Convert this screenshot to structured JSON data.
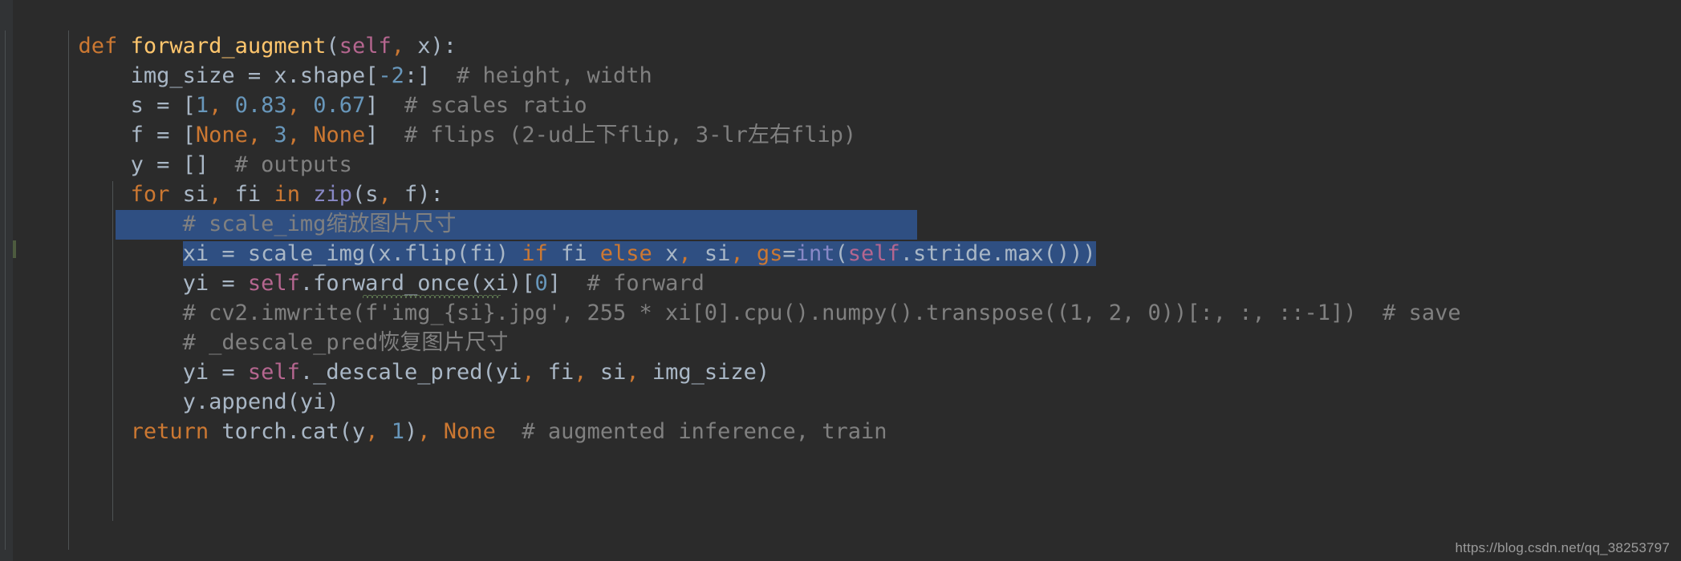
{
  "editor": {
    "language": "python",
    "theme": "darcula",
    "background_color": "#2b2b2b",
    "gutter_color": "#313335",
    "selection_color": "#2f4f82",
    "default_text_color": "#a9b7c6",
    "comment_color": "#808080",
    "keyword_color": "#cc7832",
    "number_color": "#6897bb",
    "function_color": "#ffc66d",
    "self_color": "#94558d",
    "builtin_color": "#8888c6",
    "error_squiggle_color": "#6a8759"
  },
  "code_lines": [
    {
      "id": "line-1",
      "indent": 1,
      "text": "def forward_augment(self, x):",
      "selected": false
    },
    {
      "id": "line-2",
      "indent": 2,
      "text": "img_size = x.shape[-2:]  # height, width",
      "selected": false
    },
    {
      "id": "line-3",
      "indent": 2,
      "text": "s = [1, 0.83, 0.67]  # scales ratio",
      "selected": false
    },
    {
      "id": "line-4",
      "indent": 2,
      "text": "f = [None, 3, None]  # flips (2-ud上下flip, 3-lr左右flip)",
      "selected": false
    },
    {
      "id": "line-5",
      "indent": 2,
      "text": "y = []  # outputs",
      "selected": false
    },
    {
      "id": "line-6",
      "indent": 2,
      "text": "for si, fi in zip(s, f):",
      "selected": false
    },
    {
      "id": "line-7",
      "indent": 3,
      "text": "# scale_img缩放图片尺寸",
      "selected": false
    },
    {
      "id": "line-8",
      "indent": 3,
      "text": "xi = scale_img(x.flip(fi) if fi else x, si, gs=int(self.stride.max()))",
      "selected": true
    },
    {
      "id": "line-9",
      "indent": 3,
      "text": "yi = self.forward_once(xi)[0]  # forward",
      "selected": false
    },
    {
      "id": "line-10",
      "indent": 3,
      "text": "# cv2.imwrite(f'img_{si}.jpg', 255 * xi[0].cpu().numpy().transpose((1, 2, 0))[:, :, ::-1])  # save",
      "selected": false
    },
    {
      "id": "line-11",
      "indent": 3,
      "text": "# _descale_pred恢复图片尺寸",
      "selected": false
    },
    {
      "id": "line-12",
      "indent": 3,
      "text": "yi = self._descale_pred(yi, fi, si, img_size)",
      "selected": false
    },
    {
      "id": "line-13",
      "indent": 3,
      "text": "y.append(yi)",
      "selected": false
    },
    {
      "id": "line-14",
      "indent": 2,
      "text": "return torch.cat(y, 1), None  # augmented inference, train",
      "selected": false
    }
  ],
  "watermark": {
    "text": "https://blog.csdn.net/qq_38253797"
  }
}
